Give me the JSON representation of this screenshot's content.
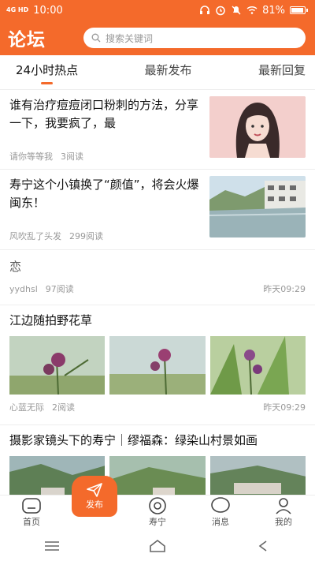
{
  "status": {
    "time": "10:00",
    "network": "4G HD",
    "battery": "81%"
  },
  "header": {
    "title": "论坛",
    "search_placeholder": "搜索关键词"
  },
  "tabs": [
    {
      "label": "24小时热点",
      "active": true
    },
    {
      "label": "最新发布",
      "active": false
    },
    {
      "label": "最新回复",
      "active": false
    }
  ],
  "posts": [
    {
      "title": "谁有治疗痘痘闭口粉刺的方法，分享一下，我要疯了，最",
      "author": "请你等等我",
      "reads": "3阅读"
    },
    {
      "title": "寿宁这个小镇换了“颜值”，将会火爆闽东！",
      "author": "风吹乱了头发",
      "reads": "299阅读"
    },
    {
      "title": "恋",
      "author": "yydhsl",
      "reads": "97阅读",
      "time": "昨天09:29"
    },
    {
      "title": "江边随拍野花草",
      "author": "心蓝无际",
      "reads": "2阅读",
      "time": "昨天09:29"
    },
    {
      "title": "摄影家镜头下的寿宁｜缪福森：绿染山村景如画"
    }
  ],
  "nav": {
    "home": "首页",
    "publish": "发布",
    "shouning": "寿宁",
    "messages": "消息",
    "mine": "我的"
  },
  "colors": {
    "accent": "#f46a2b"
  }
}
